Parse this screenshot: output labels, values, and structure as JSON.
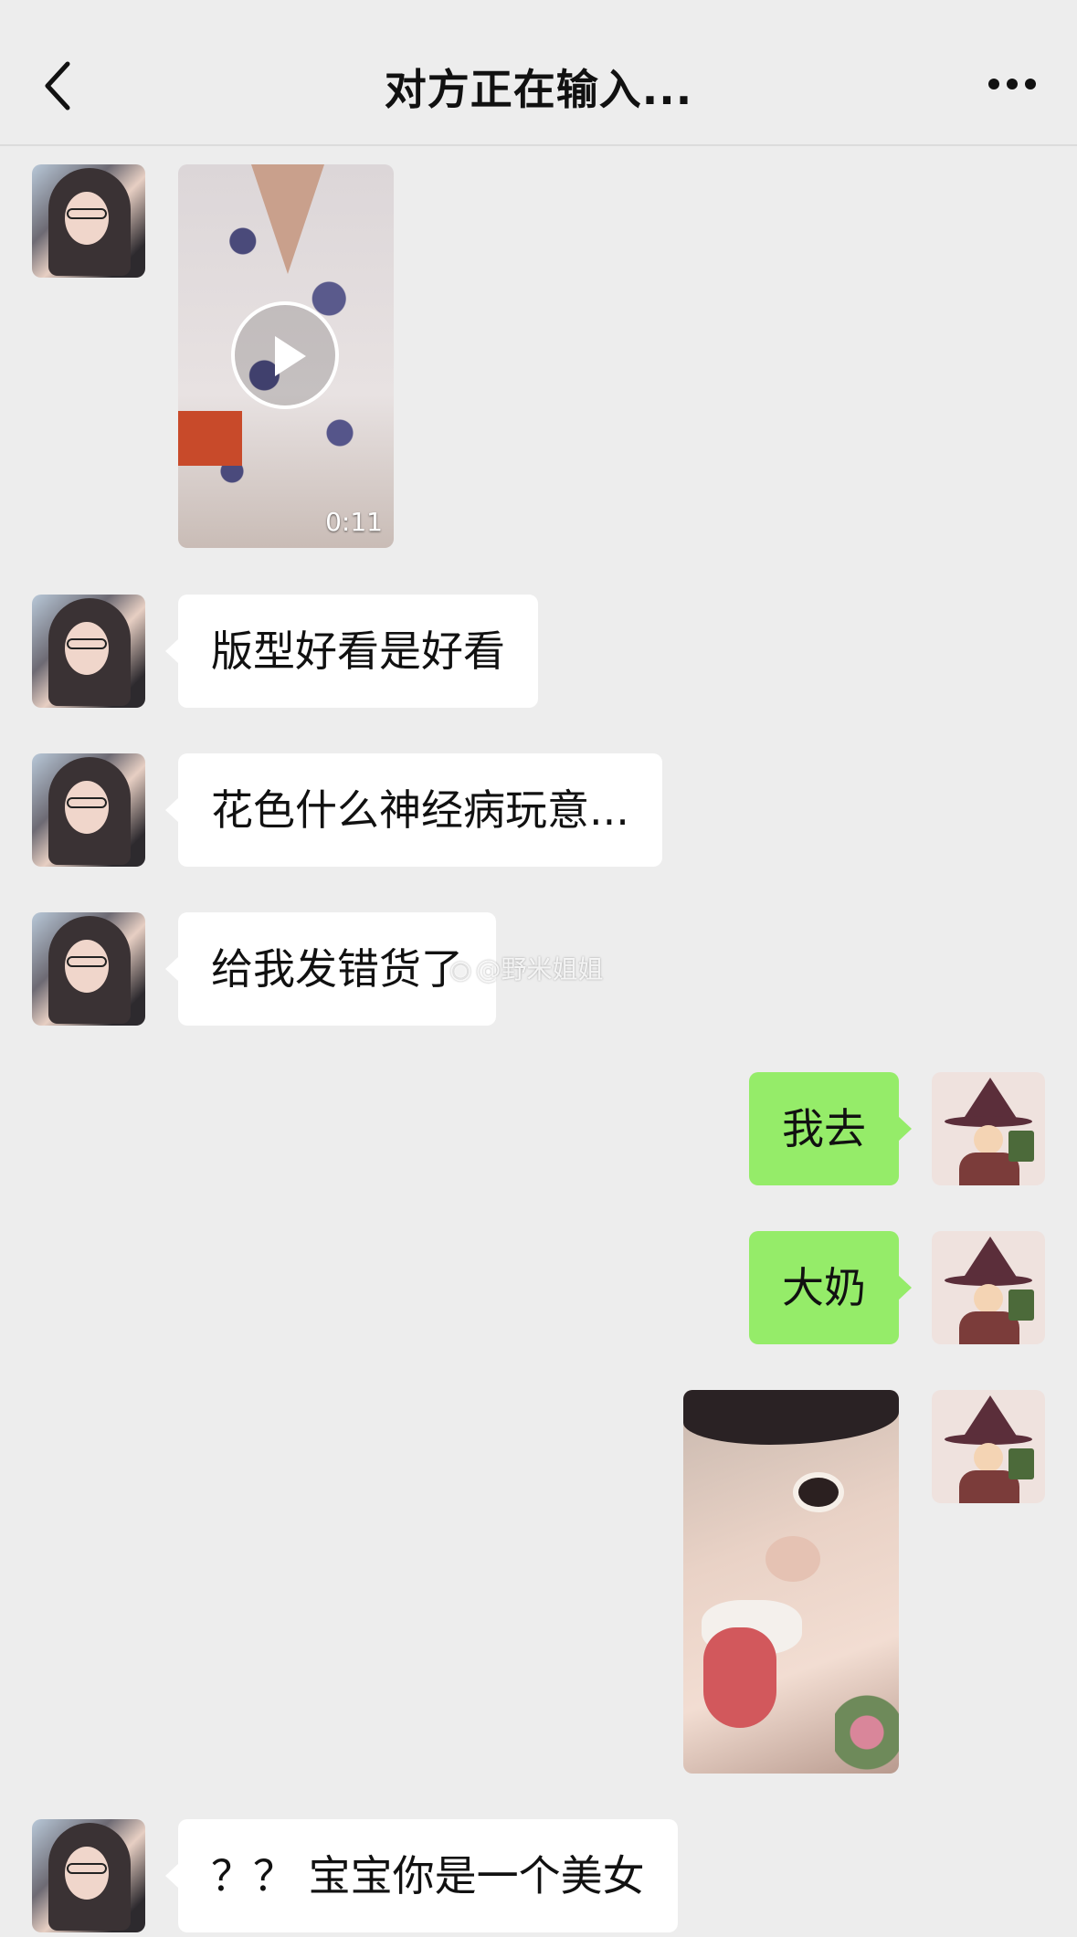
{
  "header": {
    "title": "对方正在输入...",
    "back_icon": "chevron-left-icon",
    "more_icon": "more-dots-icon"
  },
  "messages": [
    {
      "type": "video",
      "side": "in",
      "duration": "0:11"
    },
    {
      "type": "text",
      "side": "in",
      "text": "版型好看是好看"
    },
    {
      "type": "text",
      "side": "in",
      "text": "花色什么神经病玩意..."
    },
    {
      "type": "text",
      "side": "in",
      "text": "给我发错货了"
    },
    {
      "type": "text",
      "side": "out",
      "text": "我去"
    },
    {
      "type": "text",
      "side": "out",
      "text": "大奶"
    },
    {
      "type": "image",
      "side": "out"
    },
    {
      "type": "text",
      "side": "in",
      "text": "？？ 宝宝你是一个美女"
    }
  ],
  "watermark": {
    "text": "@野米姐姐",
    "icon": "weibo-icon"
  },
  "colors": {
    "background": "#ededed",
    "incoming_bubble": "#ffffff",
    "outgoing_bubble": "#95ec69"
  }
}
